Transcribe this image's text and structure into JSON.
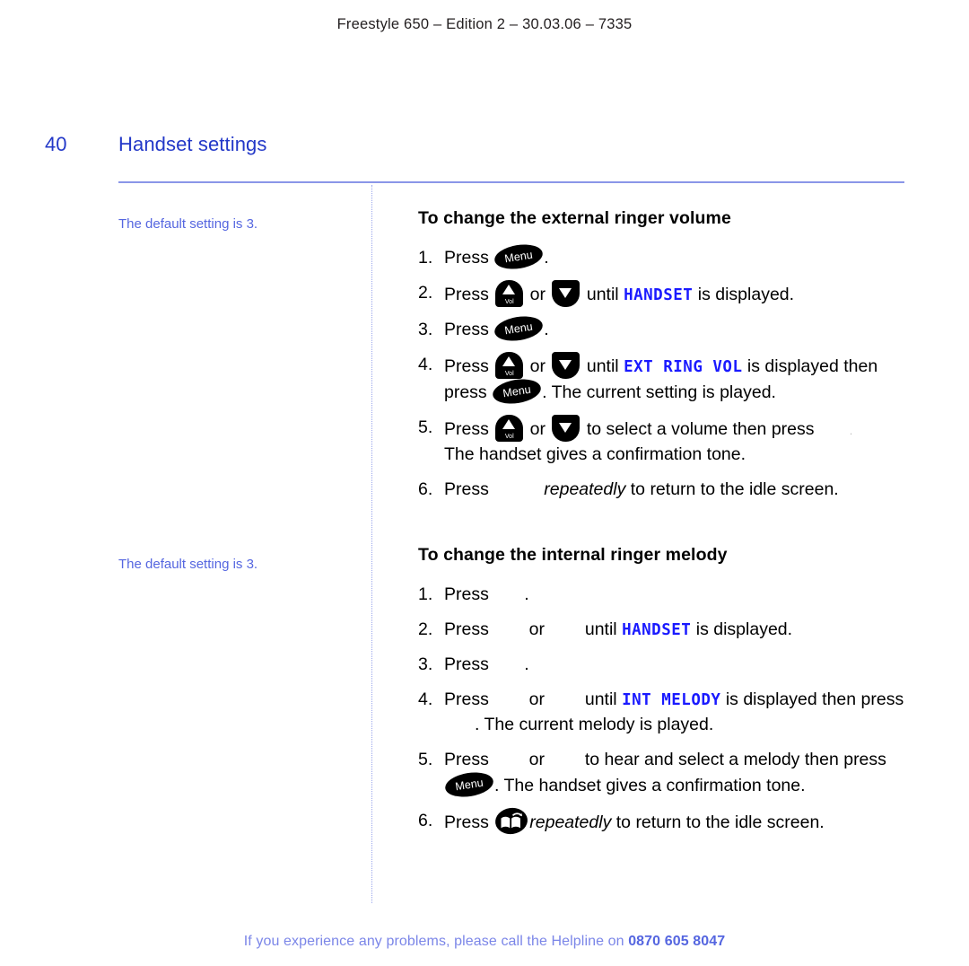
{
  "header": {
    "running_text": "Freestyle 650 – Edition 2 – 30.03.06 – 7335"
  },
  "page": {
    "number": "40",
    "title": "Handset settings",
    "rule_color": "#8a96e8",
    "title_color": "#2338c8"
  },
  "side_notes": [
    {
      "text": "The default setting is 3."
    },
    {
      "text": "The default setting is 3."
    }
  ],
  "sections": [
    {
      "heading": "To change the external ringer volume",
      "steps": [
        {
          "num": "1.",
          "parts_text": {
            "a": "Press ",
            "b": "."
          }
        },
        {
          "num": "2.",
          "parts_text": {
            "a": "Press ",
            "b": " or ",
            "c": " until ",
            "lcd": "HANDSET",
            "d": " is displayed."
          }
        },
        {
          "num": "3.",
          "parts_text": {
            "a": "Press ",
            "b": "."
          }
        },
        {
          "num": "4.",
          "parts_text": {
            "a": "Press ",
            "b": " or ",
            "c": " until ",
            "lcd": "EXT RING VOL",
            "d": " is displayed then",
            "e": "press ",
            "f": ". The current setting is played."
          }
        },
        {
          "num": "5.",
          "parts_text": {
            "a": "Press ",
            "b": " or ",
            "c": " to select a volume then press ",
            "d": ".",
            "e": "The handset gives a confirmation tone."
          }
        },
        {
          "num": "6.",
          "parts_text": {
            "a": "Press ",
            "b": "repeatedly",
            "c": " to return to the idle screen."
          }
        }
      ]
    },
    {
      "heading": "To change the internal ringer melody",
      "steps": [
        {
          "num": "1.",
          "parts_text": {
            "a": "Press ",
            "b": "."
          }
        },
        {
          "num": "2.",
          "parts_text": {
            "a": "Press ",
            "b": " or ",
            "c": " until ",
            "lcd": "HANDSET",
            "d": " is displayed."
          }
        },
        {
          "num": "3.",
          "parts_text": {
            "a": "Press ",
            "b": "."
          }
        },
        {
          "num": "4.",
          "parts_text": {
            "a": "Press ",
            "b": " or ",
            "c": " until ",
            "lcd": "INT MELODY",
            "d": " is displayed then press",
            "e": ". The current melody is played."
          }
        },
        {
          "num": "5.",
          "parts_text": {
            "a": "Press ",
            "b": " or ",
            "c": " to hear and select a melody then press",
            "d": ". The handset gives a confirmation tone."
          }
        },
        {
          "num": "6.",
          "parts_text": {
            "a": "Press ",
            "b": "repeatedly",
            "c": " to return to the idle screen."
          }
        }
      ]
    }
  ],
  "keys": {
    "menu_label": "Menu",
    "vol_label": "Vol",
    "menu_icon_name": "menu-softkey-icon",
    "up_icon_name": "volume-up-key-icon",
    "down_icon_name": "volume-down-key-icon",
    "book_icon_name": "phonebook-key-icon"
  },
  "lcd_color": "#1a1aff",
  "footer": {
    "text": "If you experience any problems, please call the Helpline on ",
    "phone": "0870 605 8047",
    "color": "#7b86e8"
  }
}
